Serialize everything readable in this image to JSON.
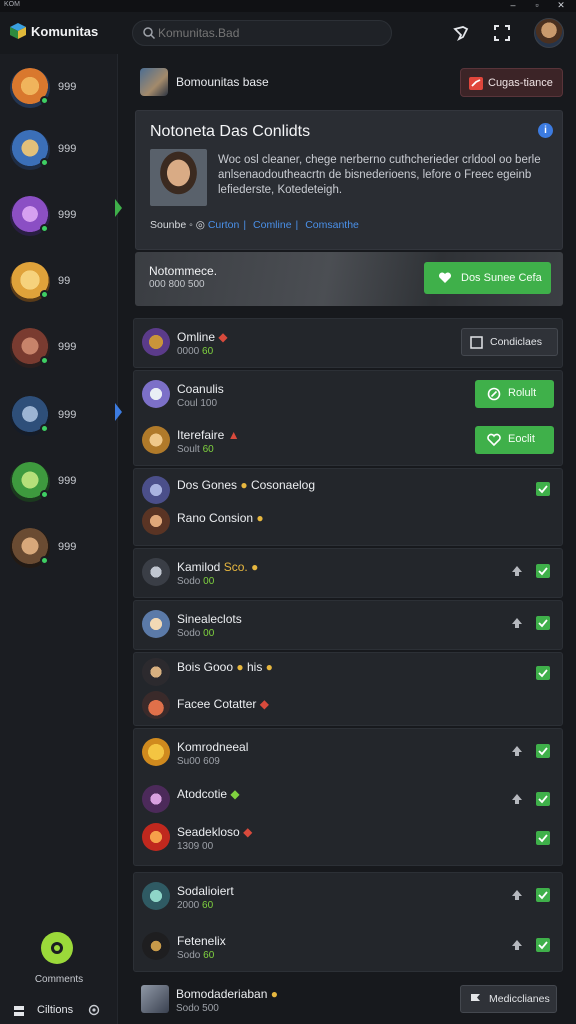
{
  "window": {
    "app_label": "KOM"
  },
  "header": {
    "app_name": "Komunitas",
    "search_placeholder": "Komunitas.Bad"
  },
  "sidebar": {
    "servers": [
      {
        "count": "999",
        "color": "#d9782e"
      },
      {
        "count": "999",
        "color": "#3b6fb8"
      },
      {
        "count": "999",
        "color": "#8b4fc4"
      },
      {
        "count": "99",
        "color": "#e0a23a"
      },
      {
        "count": "999",
        "color": "#7a3b30"
      },
      {
        "count": "999",
        "color": "#2e4f7a"
      },
      {
        "count": "999",
        "color": "#3e9a3e"
      },
      {
        "count": "999",
        "color": "#6a4b32"
      }
    ],
    "bottom_label": "Comments",
    "footer_label": "Ciltions"
  },
  "topbar": {
    "community_name": "Bomounitas base",
    "report_button": "Cugas-tiance"
  },
  "info_card": {
    "title": "Notoneta Das Conlidts",
    "description": "Woc osl cleaner, chege nerberno cuthcherieder crldool oo berle anlsenaodoutheacrtn de bisnederioens, lefore o Freec egeinb lefiederste, Kotedeteigh.",
    "link_prefix": "Sounbe",
    "links": [
      "Curton",
      "Comline",
      "Comsanthe"
    ]
  },
  "banner": {
    "title": "Notommece.",
    "subtitle": "000 800 500",
    "button_label": "Dos Sunee Cefa"
  },
  "members": {
    "online": {
      "name": "Omline",
      "sub": "0000",
      "sub_hl": "60",
      "button": "Condiclaes"
    },
    "g1": [
      {
        "name": "Coanulis",
        "sub": "Coul 100",
        "button": "Rolult"
      },
      {
        "name": "Iterefaire",
        "sub": "Soult",
        "sub_hl": "60",
        "button": "Eoclit"
      }
    ],
    "g2": [
      {
        "name": "Dos Gones",
        "badge": "Cosonaelog"
      },
      {
        "name": "Rano Consion"
      }
    ],
    "g3": [
      {
        "name": "Kamilod",
        "badge": "Sco.",
        "sub": "Sodo",
        "sub_hl": "00"
      }
    ],
    "g4": [
      {
        "name": "Sinealeclots",
        "sub": "Sodo",
        "sub_hl": "00"
      }
    ],
    "g5": [
      {
        "name": "Bois Gooo",
        "badge": "his"
      },
      {
        "name": "Facee Cotatter"
      }
    ],
    "g6": [
      {
        "name": "Komrodneeal",
        "sub": "Su00 609"
      },
      {
        "name": "Atodcotie"
      },
      {
        "name": "Seadekloso",
        "sub": "1309 00"
      }
    ],
    "g7": [
      {
        "name": "Sodalioiert",
        "sub": "2000",
        "sub_hl": "60"
      },
      {
        "name": "Fetenelix",
        "sub": "Sodo",
        "sub_hl": "60"
      }
    ],
    "last": {
      "name": "Bomodaderiaban",
      "sub": "Sodo 500",
      "button": "Medicclianes"
    }
  }
}
